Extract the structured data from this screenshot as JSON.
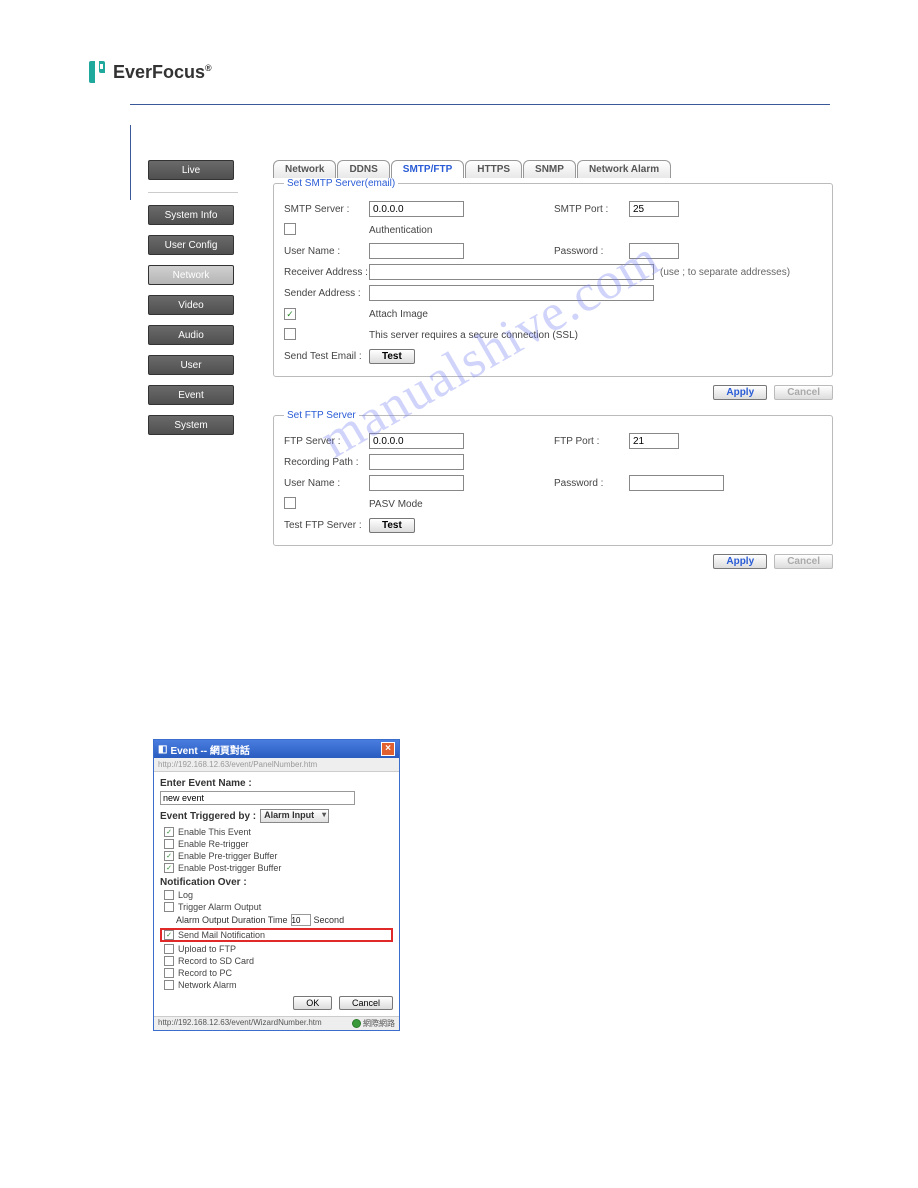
{
  "logo_text": "EverFocus",
  "logo_sup": "®",
  "sidebar": {
    "live": "Live",
    "system_info": "System Info",
    "user_config": "User Config",
    "network": "Network",
    "video": "Video",
    "audio": "Audio",
    "user": "User",
    "event": "Event",
    "system": "System"
  },
  "tabs": {
    "network": "Network",
    "ddns": "DDNS",
    "smtp_ftp": "SMTP/FTP",
    "https": "HTTPS",
    "snmp": "SNMP",
    "network_alarm": "Network Alarm"
  },
  "smtp": {
    "legend": "Set SMTP Server(email)",
    "server_lbl": "SMTP Server :",
    "server_val": "0.0.0.0",
    "port_lbl": "SMTP Port :",
    "port_val": "25",
    "auth_lbl": "Authentication",
    "user_lbl": "User Name :",
    "pass_lbl": "Password :",
    "recv_lbl": "Receiver Address :",
    "recv_hint": "(use ; to separate addresses)",
    "sender_lbl": "Sender Address :",
    "attach_lbl": "Attach Image",
    "ssl_lbl": "This server requires a secure connection (SSL)",
    "test_lbl": "Send Test Email :",
    "test_btn": "Test"
  },
  "ftp": {
    "legend": "Set FTP Server",
    "server_lbl": "FTP Server :",
    "server_val": "0.0.0.0",
    "port_lbl": "FTP Port :",
    "port_val": "21",
    "rec_lbl": "Recording Path :",
    "user_lbl": "User Name :",
    "pass_lbl": "Password :",
    "pasv_lbl": "PASV Mode",
    "test_lbl": "Test FTP Server :",
    "test_btn": "Test"
  },
  "buttons": {
    "apply": "Apply",
    "cancel": "Cancel"
  },
  "dialog": {
    "title": "Event -- 網頁對話",
    "addr": "http://192.168.12.63/event/PanelNumber.htm",
    "name_lbl": "Enter Event Name :",
    "name_val": "new event",
    "trigger_lbl": "Event Triggered by :",
    "trigger_val": "Alarm Input",
    "enable_event": "Enable This Event",
    "enable_retrigger": "Enable Re-trigger",
    "enable_pre": "Enable Pre-trigger Buffer",
    "enable_post": "Enable Post-trigger Buffer",
    "notif_lbl": "Notification Over :",
    "log": "Log",
    "trigger_alarm": "Trigger Alarm Output",
    "duration_lbl": "Alarm Output Duration Time",
    "duration_val": "10",
    "duration_unit": "Second",
    "send_mail": "Send Mail Notification",
    "upload_ftp": "Upload to FTP",
    "record_sd": "Record to SD Card",
    "record_pc": "Record to PC",
    "network_alarm": "Network Alarm",
    "ok": "OK",
    "cancel": "Cancel",
    "status_url": "http://192.168.12.63/event/WizardNumber.htm",
    "status_zone": "網際網路"
  },
  "watermark": "manualshive.com"
}
